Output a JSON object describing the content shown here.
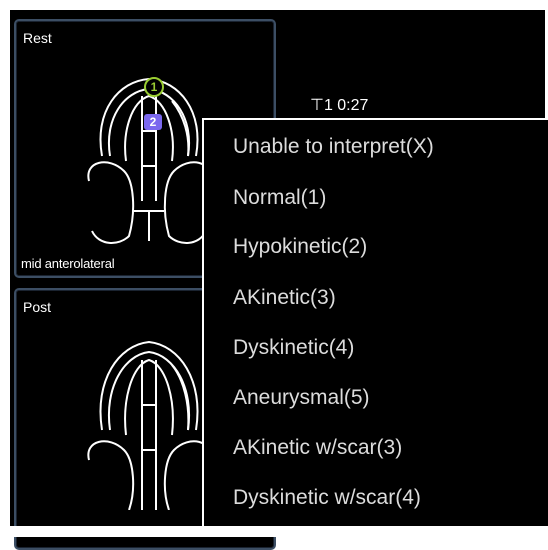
{
  "panels": {
    "rest": {
      "title": "Rest",
      "caption": "mid anterolateral",
      "segment_markers": [
        "1",
        "2"
      ]
    },
    "post": {
      "title": "Post"
    }
  },
  "info": {
    "text": "⊤1 0:27"
  },
  "context_menu": {
    "items": [
      "Unable to interpret(X)",
      "Normal(1)",
      "Hypokinetic(2)",
      "AKinetic(3)",
      "Dyskinetic(4)",
      "Aneurysmal(5)",
      "AKinetic w/scar(3)",
      "Dyskinetic w/scar(4)"
    ]
  },
  "colors": {
    "background": "#000000",
    "panel_border": "#3c4e64",
    "menu_border": "#ffffff",
    "menu_text": "#dcdcdc",
    "marker_normal": "#9acd32",
    "marker_hypokinetic": "#7b68ee"
  }
}
